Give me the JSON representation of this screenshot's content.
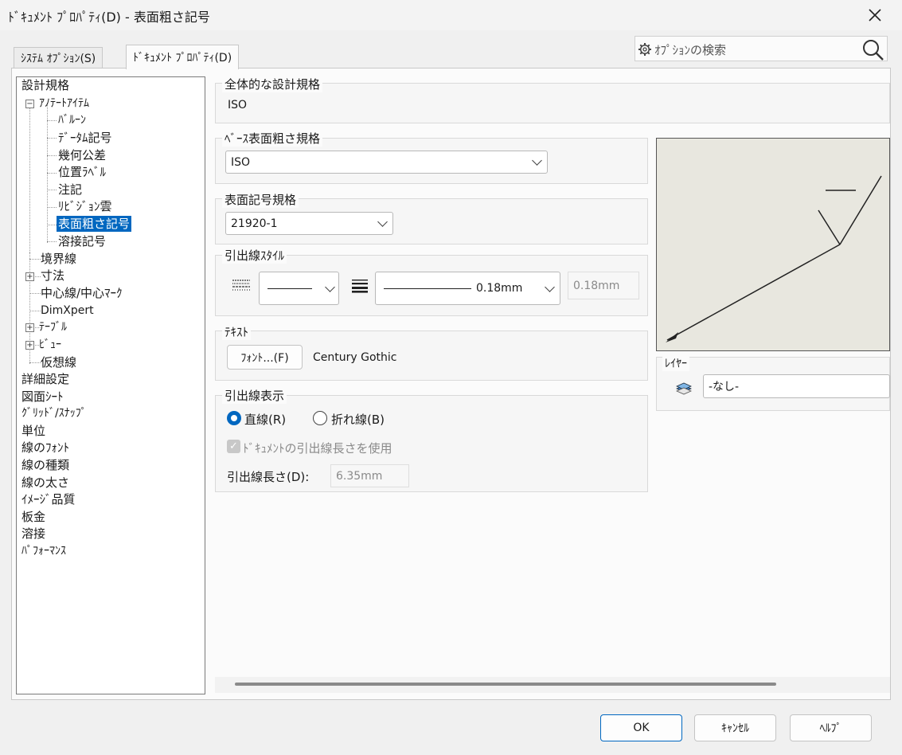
{
  "window": {
    "title": "ﾄﾞｷｭﾒﾝﾄ ﾌﾟﾛﾊﾟﾃｨ(D) - 表面粗さ記号"
  },
  "tabs": [
    {
      "label": "ｼｽﾃﾑ ｵﾌﾟｼｮﾝ(S)",
      "active": false
    },
    {
      "label": "ﾄﾞｷｭﾒﾝﾄ ﾌﾟﾛﾊﾟﾃｨ(D)",
      "active": true
    }
  ],
  "search": {
    "placeholder": "ｵﾌﾟｼｮﾝの検索",
    "icon": "search-icon"
  },
  "tree": {
    "items": [
      "設計規格",
      "ｱﾉﾃｰﾄｱｲﾃﾑ",
      "ﾊﾞﾙｰﾝ",
      "ﾃﾞｰﾀﾑ記号",
      "幾何公差",
      "位置ﾗﾍﾞﾙ",
      "注記",
      "ﾘﾋﾞｼﾞｮﾝ雲",
      "表面粗さ記号",
      "溶接記号",
      "境界線",
      "寸法",
      "中心線/中心ﾏｰｸ",
      "DimXpert",
      "ﾃｰﾌﾞﾙ",
      "ﾋﾞｭｰ",
      "仮想線",
      "詳細設定",
      "図面ｼｰﾄ",
      "ｸﾞﾘｯﾄﾞ/ｽﾅｯﾌﾟ",
      "単位",
      "線のﾌｫﾝﾄ",
      "線の種類",
      "線の太さ",
      "ｲﾒｰｼﾞ品質",
      "板金",
      "溶接",
      "ﾊﾟﾌｫｰﾏﾝｽ"
    ],
    "selected": "表面粗さ記号"
  },
  "overall": {
    "label": "全体的な設計規格",
    "value": "ISO"
  },
  "base_std": {
    "label": "ﾍﾞｰｽ表面粗さ規格",
    "value": "ISO"
  },
  "symbol_std": {
    "label": "表面記号規格",
    "value": "21920-1"
  },
  "leader_style": {
    "label": "引出線ｽﾀｲﾙ",
    "thickness_value": "0.18mm",
    "custom_value": "0.18mm"
  },
  "text": {
    "label": "ﾃｷｽﾄ",
    "font_button": "ﾌｫﾝﾄ...(F)",
    "font_name": "Century Gothic"
  },
  "leader_display": {
    "label": "引出線表示",
    "straight": "直線(R)",
    "bent": "折れ線(B)",
    "straight_checked": true,
    "use_doc_length": "ﾄﾞｷｭﾒﾝﾄの引出線長さを使用",
    "use_doc_length_checked": true,
    "length_label": "引出線長さ(D):",
    "length_value": "6.35mm"
  },
  "layer": {
    "label": "ﾚｲﾔｰ",
    "value": "-なし-"
  },
  "buttons": {
    "ok": "OK",
    "cancel": "ｷｬﾝｾﾙ",
    "help": "ﾍﾙﾌﾟ"
  },
  "colors": {
    "accent": "#0067c0",
    "preview_bg": "#e8e7df"
  }
}
